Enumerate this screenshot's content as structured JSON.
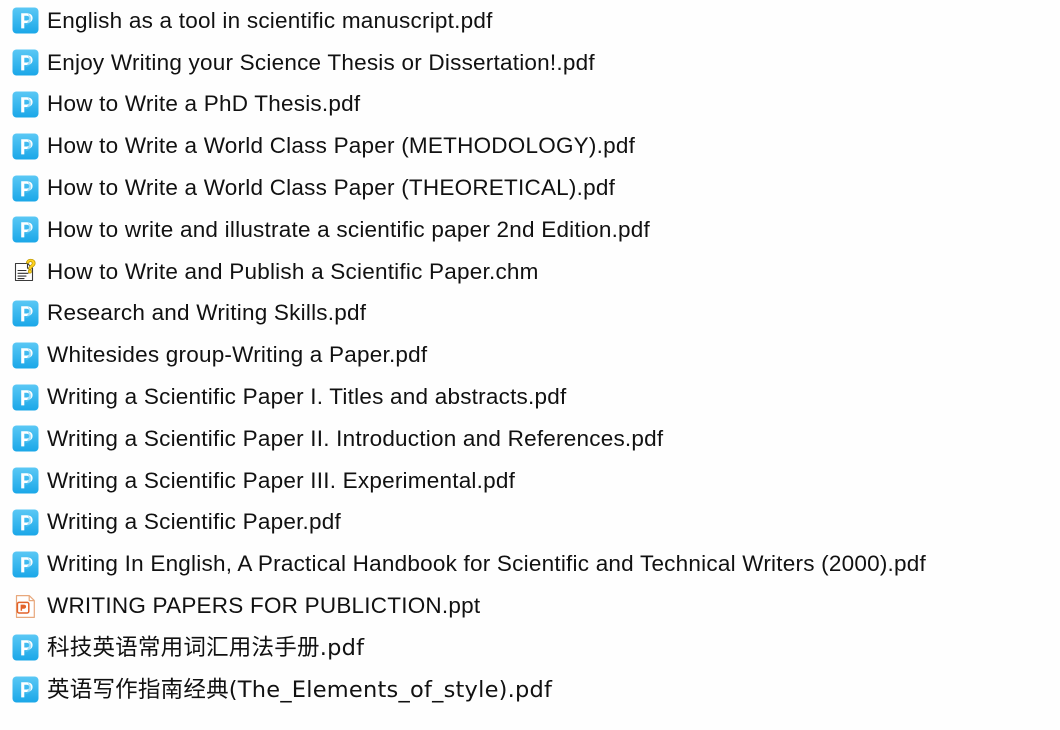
{
  "window": {
    "background_color": "#fefefe",
    "text_color": "#111111",
    "view_mode": "list"
  },
  "icons": {
    "pdf": {
      "name": "pdf-foxit-icon",
      "label": "P",
      "fill_top": "#5ac8f5",
      "fill_bottom": "#1aa7e8",
      "glyph_color": "#ffffff"
    },
    "chm": {
      "name": "chm-help-icon",
      "page_color": "#ffffff",
      "line_color": "#333333",
      "question_color": "#ffd21e"
    },
    "ppt": {
      "name": "powerpoint-file-icon",
      "page_color": "#ffffff",
      "border_color": "#e8a87c",
      "glyph_color": "#e2622a"
    }
  },
  "files": [
    {
      "name": "English as a tool in scientific manuscript.pdf",
      "type": "pdf",
      "cjk": false
    },
    {
      "name": "Enjoy Writing your Science Thesis or Dissertation!.pdf",
      "type": "pdf",
      "cjk": false
    },
    {
      "name": "How to Write a PhD Thesis.pdf",
      "type": "pdf",
      "cjk": false
    },
    {
      "name": "How to Write a World Class Paper (METHODOLOGY).pdf",
      "type": "pdf",
      "cjk": false
    },
    {
      "name": "How to Write a World Class Paper (THEORETICAL).pdf",
      "type": "pdf",
      "cjk": false
    },
    {
      "name": "How to write and illustrate a scientific paper 2nd Edition.pdf",
      "type": "pdf",
      "cjk": false
    },
    {
      "name": "How to Write and Publish a Scientific Paper.chm",
      "type": "chm",
      "cjk": false
    },
    {
      "name": "Research and Writing Skills.pdf",
      "type": "pdf",
      "cjk": false
    },
    {
      "name": "Whitesides group-Writing a Paper.pdf",
      "type": "pdf",
      "cjk": false
    },
    {
      "name": "Writing a Scientific Paper I. Titles and abstracts.pdf",
      "type": "pdf",
      "cjk": false
    },
    {
      "name": "Writing a Scientific Paper II. Introduction and References.pdf",
      "type": "pdf",
      "cjk": false
    },
    {
      "name": "Writing a Scientific Paper III. Experimental.pdf",
      "type": "pdf",
      "cjk": false
    },
    {
      "name": "Writing a Scientific Paper.pdf",
      "type": "pdf",
      "cjk": false
    },
    {
      "name": "Writing In English, A Practical Handbook for Scientific and Technical Writers (2000).pdf",
      "type": "pdf",
      "cjk": false
    },
    {
      "name": "WRITING PAPERS FOR PUBLICTION.ppt",
      "type": "ppt",
      "cjk": false
    },
    {
      "name": "科技英语常用词汇用法手册.pdf",
      "type": "pdf",
      "cjk": true
    },
    {
      "name": "英语写作指南经典(The_Elements_of_style).pdf",
      "type": "pdf",
      "cjk": true
    }
  ]
}
